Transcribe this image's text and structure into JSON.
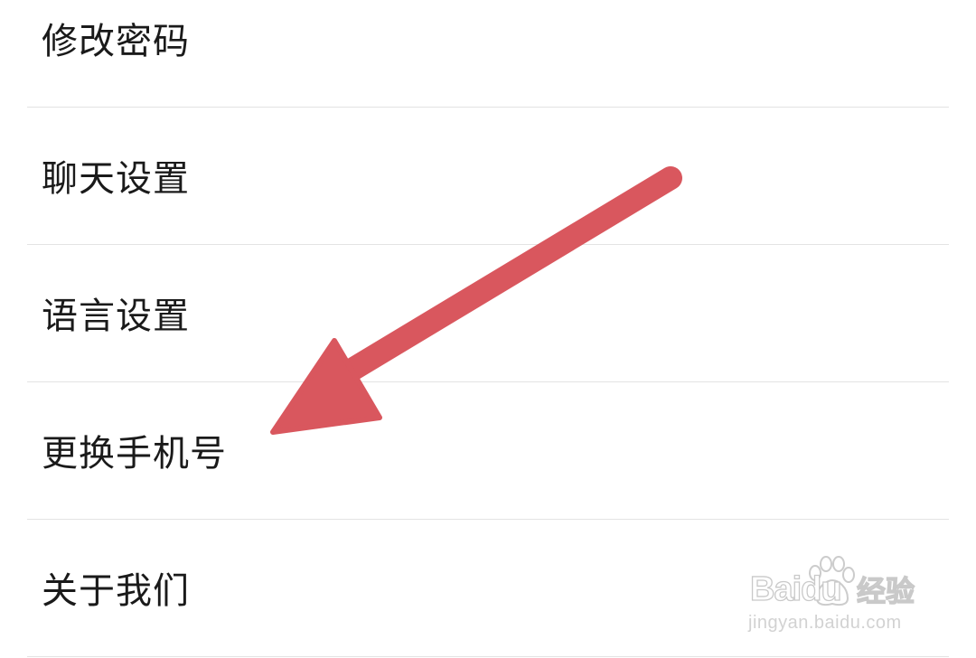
{
  "settings": {
    "items": [
      {
        "id": "change-password",
        "label": "修改密码"
      },
      {
        "id": "chat-settings",
        "label": "聊天设置"
      },
      {
        "id": "language-settings",
        "label": "语言设置"
      },
      {
        "id": "change-phone",
        "label": "更换手机号"
      },
      {
        "id": "about-us",
        "label": "关于我们"
      }
    ]
  },
  "annotation": {
    "arrow_color": "#d9575e",
    "points_to": "change-phone",
    "icon": "arrow-annotation-icon"
  },
  "watermark": {
    "brand": "Baidu",
    "product": "经验",
    "url": "jingyan.baidu.com",
    "icon": "baidu-paw-icon"
  },
  "colors": {
    "background": "#ffffff",
    "text": "#1a1a1a",
    "divider": "#e3e3e3"
  }
}
